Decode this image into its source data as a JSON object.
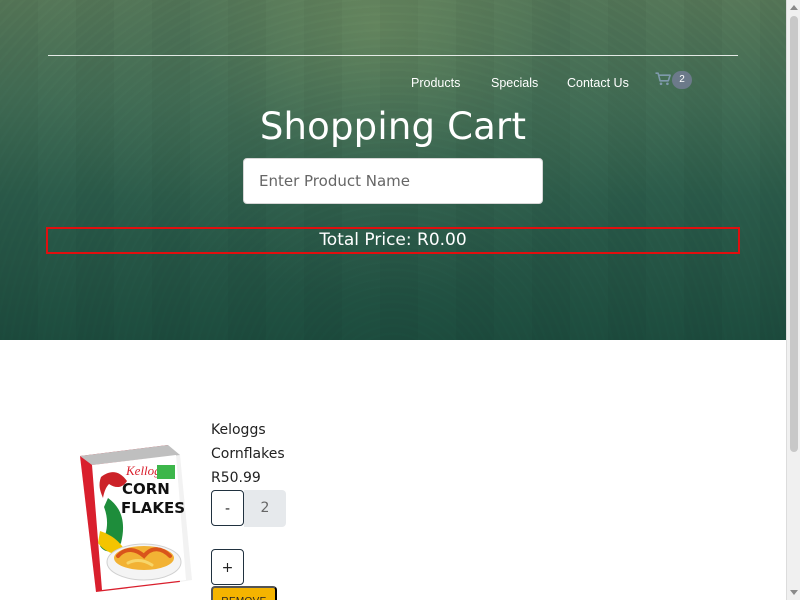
{
  "header": {
    "title": "Shopping Cart",
    "search_placeholder": "Enter Product Name",
    "total_price": "Total Price: R0.00",
    "nav": {
      "products": "Products",
      "specials": "Specials",
      "contact": "Contact Us",
      "cart_count": "2"
    }
  },
  "cart": {
    "items": [
      {
        "name_line1": "Keloggs",
        "name_line2": "Cornflakes",
        "price": "R50.99",
        "quantity": "2",
        "minus_label": "-",
        "plus_label": "+",
        "remove_label": "REMOVE"
      }
    ]
  },
  "colors": {
    "hero_top": "#557657",
    "hero_bottom": "#1c4b3d",
    "total_border": "#e10f0f",
    "remove_button": "#f5b400",
    "cart_badge": "#6c7a8a"
  },
  "icons": {
    "cart": "cart-icon"
  }
}
